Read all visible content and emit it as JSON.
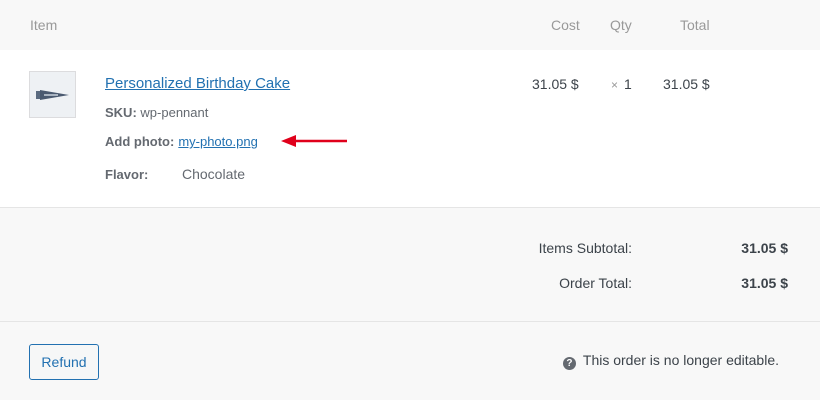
{
  "header": {
    "item": "Item",
    "cost": "Cost",
    "qty": "Qty",
    "total": "Total"
  },
  "line_item": {
    "name": "Personalized Birthday Cake",
    "sku_label": "SKU:",
    "sku_value": "wp-pennant",
    "photo_label": "Add photo:",
    "photo_value": "my-photo.png",
    "flavor_label": "Flavor:",
    "flavor_value": "Chocolate",
    "cost": "31.05 $",
    "qty_symbol": "×",
    "qty": "1",
    "total": "31.05 $",
    "thumbnail_icon": "pennant-icon"
  },
  "totals": {
    "subtotal_label": "Items Subtotal:",
    "subtotal_value": "31.05 $",
    "order_total_label": "Order Total:",
    "order_total_value": "31.05 $"
  },
  "footer": {
    "refund_label": "Refund",
    "notice": "This order is no longer editable.",
    "help_icon_glyph": "?"
  },
  "colors": {
    "link": "#2271b1",
    "arrow": "#e0001b"
  }
}
